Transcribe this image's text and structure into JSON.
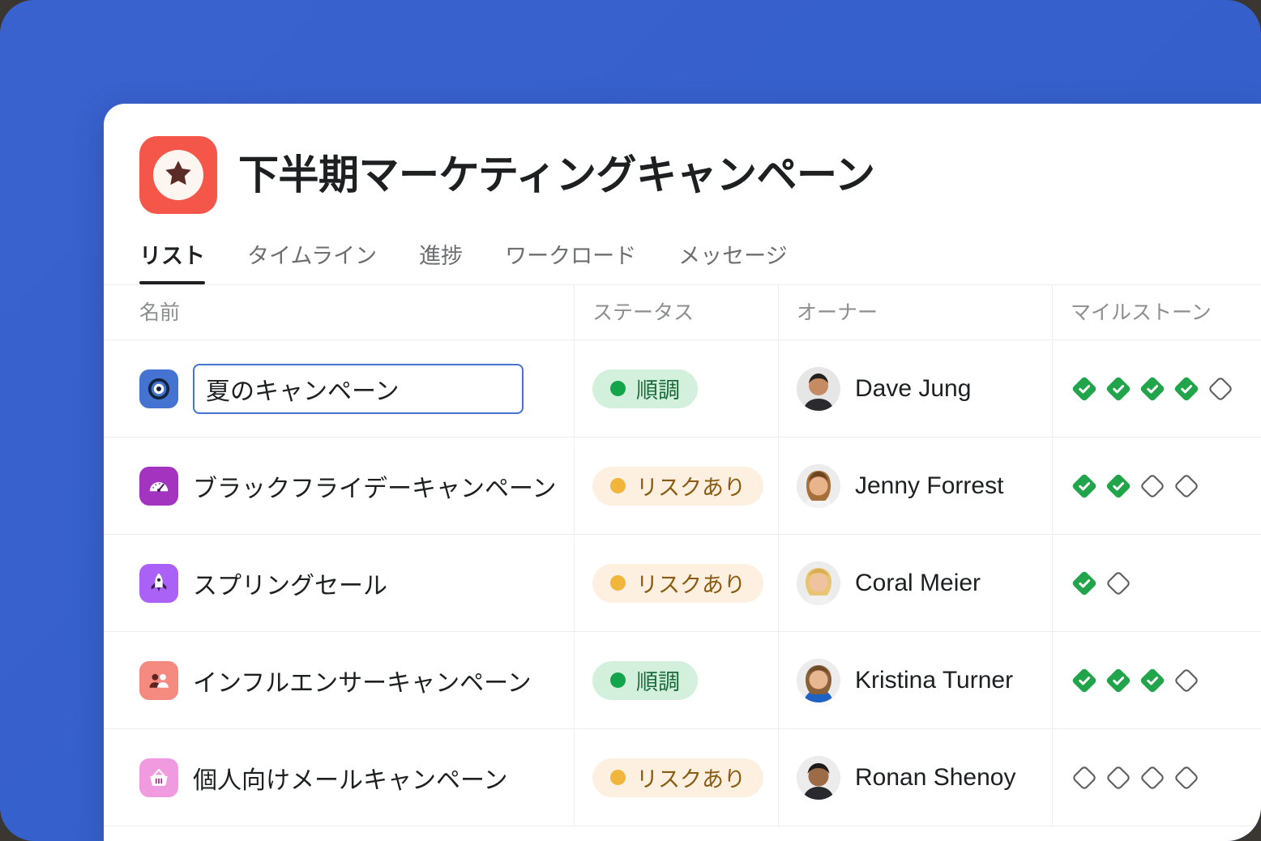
{
  "theme": {
    "background_blue": "#3660cc",
    "logo_red": "#f5564a",
    "accent_blue": "#4573d2",
    "green": "#14a44a",
    "amber": "#f2b53c",
    "text_dark": "#1e1f21",
    "text_muted": "#8d8e8f"
  },
  "header": {
    "logo_icon": "star-icon",
    "title": "下半期マーケティングキャンペーン"
  },
  "tabs": [
    {
      "label": "リスト",
      "active": true
    },
    {
      "label": "タイムライン",
      "active": false
    },
    {
      "label": "進捗",
      "active": false
    },
    {
      "label": "ワークロード",
      "active": false
    },
    {
      "label": "メッセージ",
      "active": false
    }
  ],
  "table": {
    "columns": [
      {
        "key": "name",
        "label": "名前"
      },
      {
        "key": "status",
        "label": "ステータス"
      },
      {
        "key": "owner",
        "label": "オーナー"
      },
      {
        "key": "milestone",
        "label": "マイルストーン"
      }
    ],
    "rows": [
      {
        "icon": "target-icon",
        "icon_color": "#4573d2",
        "name": "夏のキャンペーン",
        "editing": true,
        "status": {
          "label": "順調",
          "type": "ontrack"
        },
        "owner": {
          "name": "Dave Jung",
          "avatar": "avatar-dave-jung"
        },
        "milestones": {
          "total": 5,
          "done": 4
        }
      },
      {
        "icon": "speedometer-icon",
        "icon_color": "#a234c0",
        "name": "ブラックフライデーキャンペーン",
        "editing": false,
        "status": {
          "label": "リスクあり",
          "type": "atrisk"
        },
        "owner": {
          "name": "Jenny Forrest",
          "avatar": "avatar-jenny-forrest"
        },
        "milestones": {
          "total": 4,
          "done": 2
        }
      },
      {
        "icon": "rocket-icon",
        "icon_color": "#a962f5",
        "name": "スプリングセール",
        "editing": false,
        "status": {
          "label": "リスクあり",
          "type": "atrisk"
        },
        "owner": {
          "name": "Coral Meier",
          "avatar": "avatar-coral-meier"
        },
        "milestones": {
          "total": 2,
          "done": 1
        }
      },
      {
        "icon": "people-icon",
        "icon_color": "#f58b80",
        "name": "インフルエンサーキャンペーン",
        "editing": false,
        "status": {
          "label": "順調",
          "type": "ontrack"
        },
        "owner": {
          "name": "Kristina Turner",
          "avatar": "avatar-kristina-turner"
        },
        "milestones": {
          "total": 4,
          "done": 3
        }
      },
      {
        "icon": "basket-icon",
        "icon_color": "#f09ae0",
        "name": "個人向けメールキャンペーン",
        "editing": false,
        "status": {
          "label": "リスクあり",
          "type": "atrisk"
        },
        "owner": {
          "name": "Ronan Shenoy",
          "avatar": "avatar-ronan-shenoy"
        },
        "milestones": {
          "total": 4,
          "done": 0
        }
      }
    ]
  }
}
